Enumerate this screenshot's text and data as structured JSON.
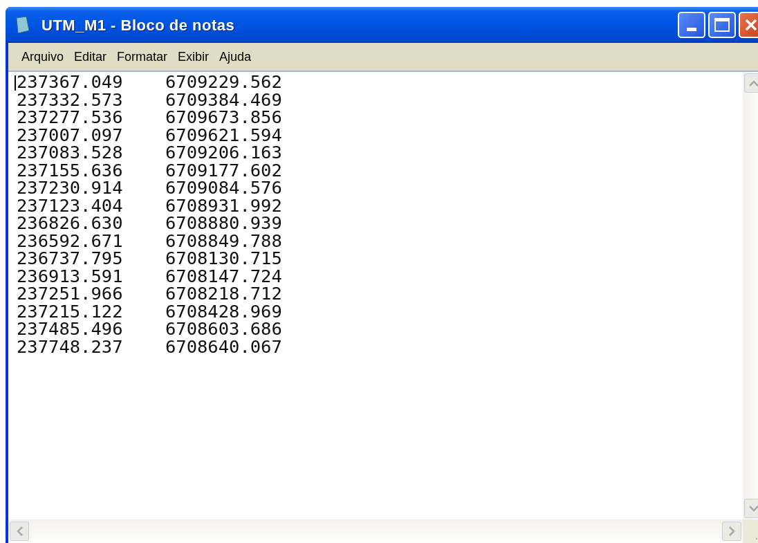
{
  "window": {
    "title": "UTM_M1 - Bloco de notas"
  },
  "menu": [
    "Arquivo",
    "Editar",
    "Formatar",
    "Exibir",
    "Ajuda"
  ],
  "lines": [
    "237367.049    6709229.562",
    "237332.573    6709384.469",
    "237277.536    6709673.856",
    "237007.097    6709621.594",
    "237083.528    6709206.163",
    "237155.636    6709177.602",
    "237230.914    6709084.576",
    "237123.404    6708931.992",
    "236826.630    6708880.939",
    "236592.671    6708849.788",
    "236737.795    6708130.715",
    "236913.591    6708147.724",
    "237251.966    6708218.712",
    "237215.122    6708428.969",
    "237485.496    6708603.686",
    "237748.237    6708640.067"
  ]
}
